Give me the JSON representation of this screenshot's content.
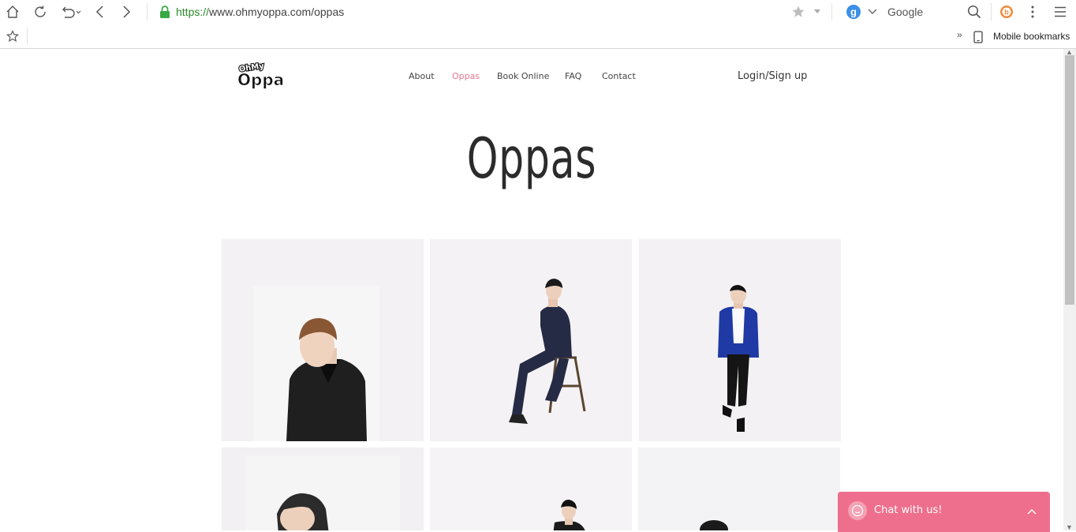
{
  "browser": {
    "url_secure": "https://",
    "url_rest": "www.ohmyoppa.com/oppas",
    "search_engine_label": "Google",
    "bookmark_folder": "Mobile bookmarks",
    "overflow_chevron": "»"
  },
  "site": {
    "logo_alt": "OhMy Oppa",
    "logo_top": "OhMy",
    "logo_bottom": "Oppa",
    "nav": [
      {
        "label": "About",
        "active": false
      },
      {
        "label": "Oppas",
        "active": true
      },
      {
        "label": "Book Online",
        "active": false
      },
      {
        "label": "FAQ",
        "active": false
      },
      {
        "label": "Contact",
        "active": false
      }
    ],
    "login_label": "Login/Sign up",
    "page_title": "Oppas"
  },
  "chat": {
    "label": "Chat with us!"
  },
  "colors": {
    "accent_pink": "#e8768f",
    "chat_pink": "#ee6f8d",
    "secure_green": "#2a8a2a"
  }
}
